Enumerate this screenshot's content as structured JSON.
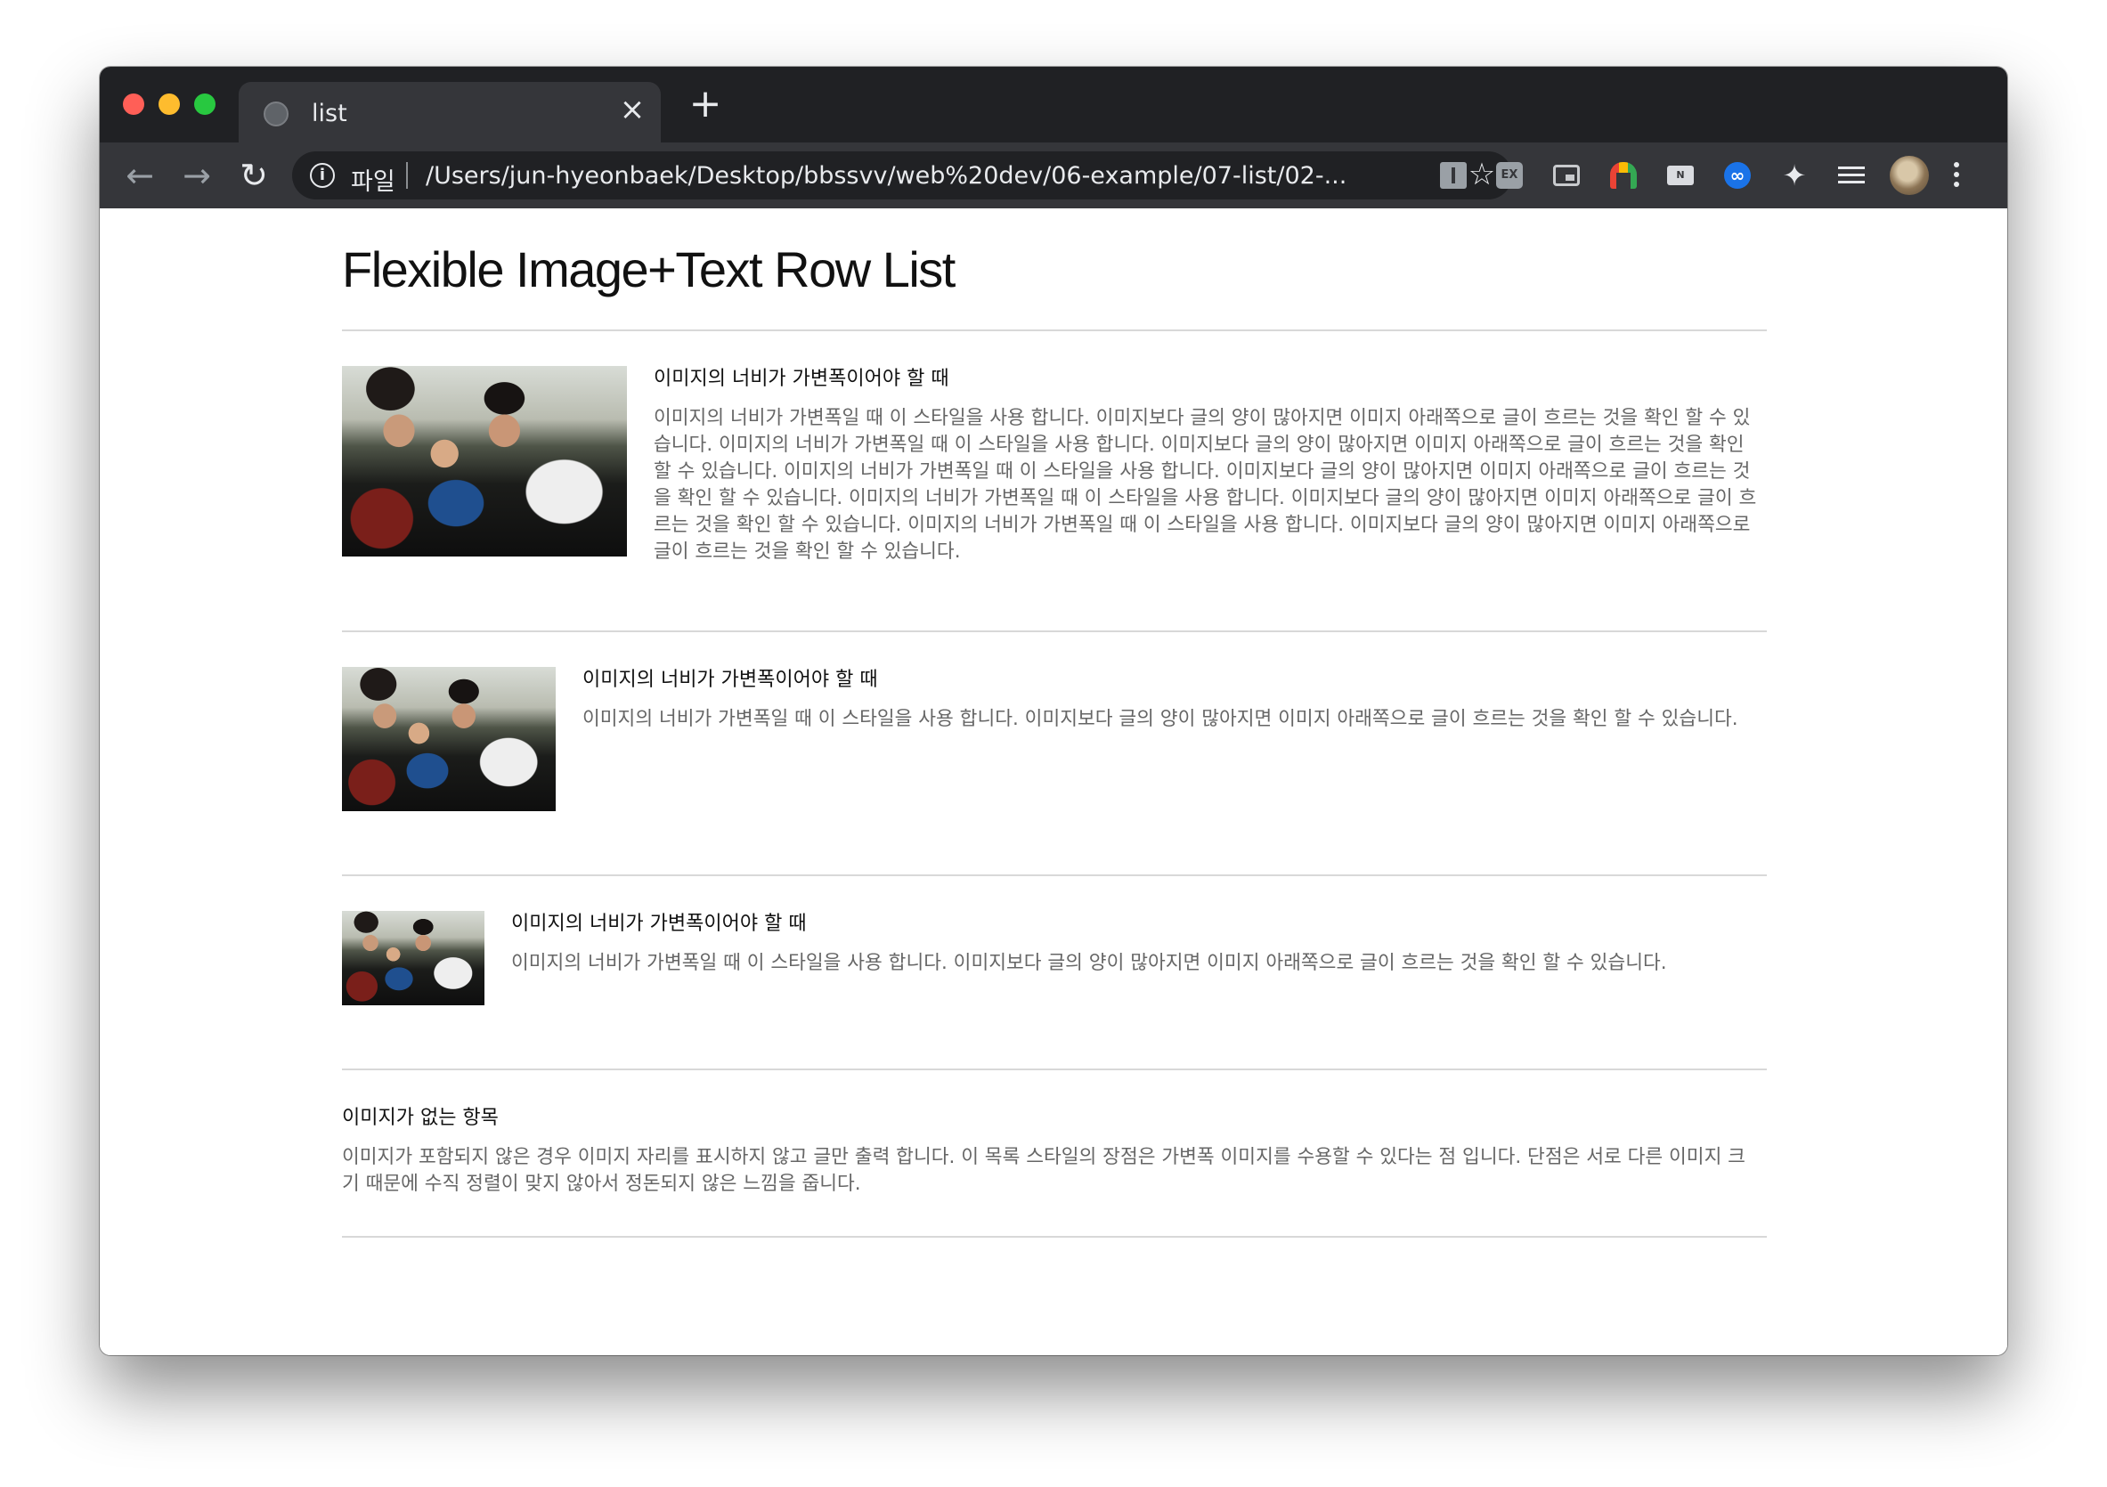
{
  "browser": {
    "tab_title": "list",
    "tab_close": "×",
    "new_tab": "+",
    "scheme_label": "파일",
    "url": "/Users/jun-hyeonbaek/Desktop/bbssvv/web%20dev/06-example/07-list/02-...",
    "nav": {
      "back": "←",
      "forward": "→",
      "reload": "↻"
    },
    "star": "☆",
    "icons": [
      "info-icon",
      "star-icon",
      "puzzle-icon",
      "playlist-icon",
      "avatar",
      "menu-icon"
    ],
    "extension_labels": {
      "ex": "EX",
      "notes": "N",
      "loop": "∞",
      "puzzle": "✦"
    }
  },
  "page": {
    "title": "Flexible Image+Text Row List",
    "items": [
      {
        "title": "이미지의 너비가 가변폭이어야 할 때",
        "desc": "이미지의 너비가 가변폭일 때 이 스타일을 사용 합니다. 이미지보다 글의 양이 많아지면 이미지 아래쪽으로 글이 흐르는 것을 확인 할 수 있습니다. 이미지의 너비가 가변폭일 때 이 스타일을 사용 합니다. 이미지보다 글의 양이 많아지면 이미지 아래쪽으로 글이 흐르는 것을 확인 할 수 있습니다. 이미지의 너비가 가변폭일 때 이 스타일을 사용 합니다. 이미지보다 글의 양이 많아지면 이미지 아래쪽으로 글이 흐르는 것을 확인 할 수 있습니다. 이미지의 너비가 가변폭일 때 이 스타일을 사용 합니다. 이미지보다 글의 양이 많아지면 이미지 아래쪽으로 글이 흐르는 것을 확인 할 수 있습니다. 이미지의 너비가 가변폭일 때 이 스타일을 사용 합니다. 이미지보다 글의 양이 많아지면 이미지 아래쪽으로 글이 흐르는 것을 확인 할 수 있습니다."
      },
      {
        "title": "이미지의 너비가 가변폭이어야 할 때",
        "desc": "이미지의 너비가 가변폭일 때 이 스타일을 사용 합니다. 이미지보다 글의 양이 많아지면 이미지 아래쪽으로 글이 흐르는 것을 확인 할 수 있습니다."
      },
      {
        "title": "이미지의 너비가 가변폭이어야 할 때",
        "desc": "이미지의 너비가 가변폭일 때 이 스타일을 사용 합니다. 이미지보다 글의 양이 많아지면 이미지 아래쪽으로 글이 흐르는 것을 확인 할 수 있습니다."
      },
      {
        "title": "이미지가 없는 항목",
        "desc": "이미지가 포함되지 않은 경우 이미지 자리를 표시하지 않고 글만 출력 합니다. 이 목록 스타일의 장점은 가변폭 이미지를 수용할 수 있다는 점 입니다. 단점은 서로 다른 이미지 크기 때문에 수직 정렬이 맞지 않아서 정돈되지 않은 느낌을 줍니다."
      }
    ]
  }
}
